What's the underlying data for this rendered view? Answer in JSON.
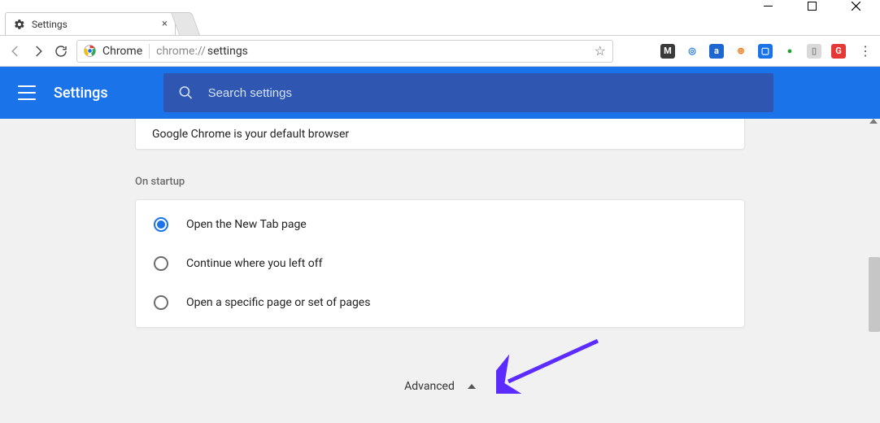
{
  "window": {
    "tab_title": "Settings"
  },
  "toolbar": {
    "secure_label": "Chrome",
    "url_prefix": "chrome://",
    "url_path": "settings"
  },
  "header": {
    "title": "Settings",
    "search_placeholder": "Search settings"
  },
  "default_browser_card": {
    "text": "Google Chrome is your default browser"
  },
  "startup": {
    "section_label": "On startup",
    "options": [
      {
        "label": "Open the New Tab page",
        "selected": true
      },
      {
        "label": "Continue where you left off",
        "selected": false
      },
      {
        "label": "Open a specific page or set of pages",
        "selected": false
      }
    ]
  },
  "advanced": {
    "label": "Advanced"
  },
  "extensions": [
    {
      "name": "m-ext",
      "bg": "#3a3a3a",
      "char": "M"
    },
    {
      "name": "circle-blue-ext",
      "bg": "#ffffff",
      "char": "◎",
      "fg": "#1a73e8"
    },
    {
      "name": "circle-a-ext",
      "bg": "#1e66d0",
      "char": "a"
    },
    {
      "name": "circle-h-ext",
      "bg": "#ffffff",
      "char": "⊚",
      "fg": "#ef6c00"
    },
    {
      "name": "box-blue-ext",
      "bg": "#1a73e8",
      "char": "▢"
    },
    {
      "name": "green-dot-ext",
      "bg": "#ffffff",
      "char": "●",
      "fg": "#1da332"
    },
    {
      "name": "doc-ext",
      "bg": "#d9d9d9",
      "char": "▯",
      "fg": "#888"
    },
    {
      "name": "red-g-ext",
      "bg": "#e53935",
      "char": "G"
    }
  ]
}
